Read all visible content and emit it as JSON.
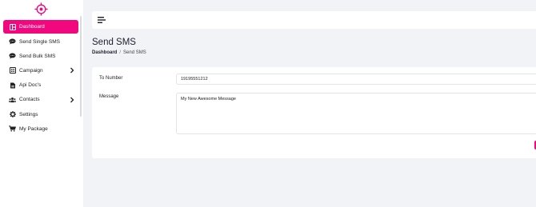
{
  "brand": {
    "accent": "#f2087e",
    "logo_icon": "target-icon"
  },
  "sidebar": {
    "items": [
      {
        "label": "Dashboard",
        "icon": "dashboard-icon",
        "active": true
      },
      {
        "label": "Send Single SMS",
        "icon": "chat-icon"
      },
      {
        "label": "Send Bulk SMS",
        "icon": "chat-icon"
      },
      {
        "label": "Campaign",
        "icon": "campaign-icon",
        "has_children": true
      },
      {
        "label": "Api Doc's",
        "icon": "document-icon"
      },
      {
        "label": "Contacts",
        "icon": "contacts-icon",
        "has_children": true
      },
      {
        "label": "Settings",
        "icon": "gear-icon"
      },
      {
        "label": "My Package",
        "icon": "cart-icon"
      }
    ]
  },
  "header": {
    "menu_icon": "hamburger-icon"
  },
  "page": {
    "title": "Send SMS",
    "breadcrumb": {
      "home": "Dashboard",
      "separator": "/",
      "current": "Send SMS"
    }
  },
  "form": {
    "to_number_label": "To Number",
    "to_number_value": "19195551212",
    "message_label": "Message",
    "message_value": "My New Awesome Message"
  }
}
